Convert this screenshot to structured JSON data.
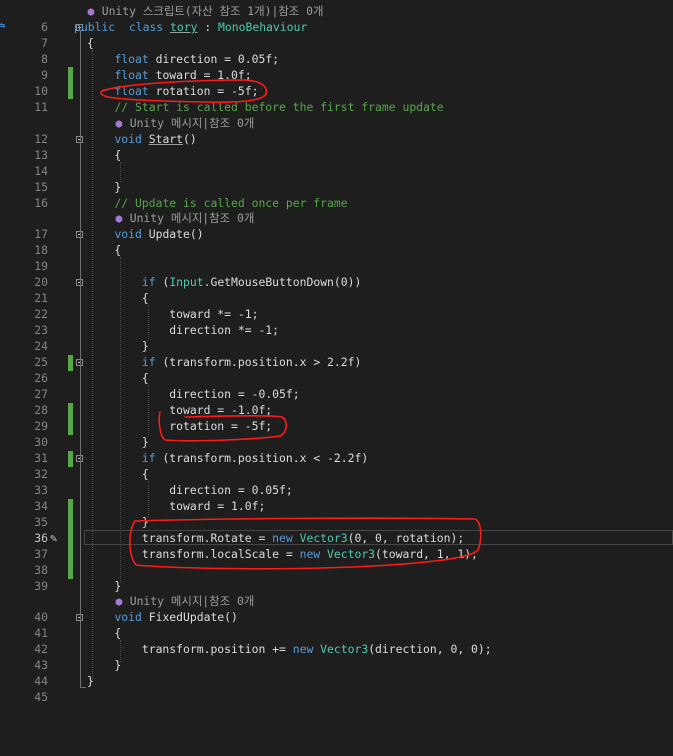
{
  "editor": {
    "lens_label": "Unity 메시지|참조 0개",
    "lens_label_class": "Unity 스크립트(자산 참조 1개)|참조 0개",
    "lines": [
      {
        "n": "6",
        "segs": [
          [
            "kw",
            "public"
          ],
          [
            "",
            "  "
          ],
          [
            "kw",
            "class"
          ],
          [
            "",
            " "
          ],
          [
            "type und",
            "tory"
          ],
          [
            "",
            " : "
          ],
          [
            "type",
            "MonoBehaviour"
          ]
        ]
      },
      {
        "n": "7",
        "segs": [
          [
            "",
            "{"
          ]
        ]
      },
      {
        "n": "8",
        "segs": [
          [
            "",
            "    "
          ],
          [
            "kw",
            "float"
          ],
          [
            "",
            " direction = 0.05f;"
          ]
        ]
      },
      {
        "n": "9",
        "segs": [
          [
            "",
            "    "
          ],
          [
            "kw",
            "float"
          ],
          [
            "",
            " toward = 1.0f;"
          ]
        ]
      },
      {
        "n": "10",
        "segs": [
          [
            "",
            "    "
          ],
          [
            "kw",
            "float"
          ],
          [
            "",
            " rotation = -5f;"
          ]
        ]
      },
      {
        "n": "11",
        "segs": [
          [
            "",
            "    "
          ],
          [
            "com",
            "// Start is called before the first frame update"
          ]
        ]
      },
      {
        "n": "12",
        "segs": [
          [
            "",
            "    "
          ],
          [
            "kw",
            "void"
          ],
          [
            "",
            " "
          ],
          [
            "und",
            "Start"
          ],
          [
            "",
            "()"
          ]
        ]
      },
      {
        "n": "13",
        "segs": [
          [
            "",
            "    {"
          ]
        ]
      },
      {
        "n": "14",
        "segs": [
          [
            "",
            ""
          ]
        ]
      },
      {
        "n": "15",
        "segs": [
          [
            "",
            "    }"
          ]
        ]
      },
      {
        "n": "16",
        "segs": [
          [
            "",
            "    "
          ],
          [
            "com",
            "// Update is called once per frame"
          ]
        ]
      },
      {
        "n": "17",
        "segs": [
          [
            "",
            "    "
          ],
          [
            "kw",
            "void"
          ],
          [
            "",
            " Update()"
          ]
        ]
      },
      {
        "n": "18",
        "segs": [
          [
            "",
            "    {"
          ]
        ]
      },
      {
        "n": "19",
        "segs": [
          [
            "",
            ""
          ]
        ]
      },
      {
        "n": "20",
        "segs": [
          [
            "",
            "        "
          ],
          [
            "kw",
            "if"
          ],
          [
            "",
            " ("
          ],
          [
            "type",
            "Input"
          ],
          [
            "",
            ".GetMouseButtonDown(0))"
          ]
        ]
      },
      {
        "n": "21",
        "segs": [
          [
            "",
            "        {"
          ]
        ]
      },
      {
        "n": "22",
        "segs": [
          [
            "",
            "            toward *= -1;"
          ]
        ]
      },
      {
        "n": "23",
        "segs": [
          [
            "",
            "            direction *= -1;"
          ]
        ]
      },
      {
        "n": "24",
        "segs": [
          [
            "",
            "        }"
          ]
        ]
      },
      {
        "n": "25",
        "segs": [
          [
            "",
            "        "
          ],
          [
            "kw",
            "if"
          ],
          [
            "",
            " (transform.position.x > 2.2f)"
          ]
        ]
      },
      {
        "n": "26",
        "segs": [
          [
            "",
            "        {"
          ]
        ]
      },
      {
        "n": "27",
        "segs": [
          [
            "",
            "            direction = -0.05f;"
          ]
        ]
      },
      {
        "n": "28",
        "segs": [
          [
            "",
            "            toward = -1.0f;"
          ]
        ]
      },
      {
        "n": "29",
        "segs": [
          [
            "",
            "            rotation = -5f;"
          ]
        ]
      },
      {
        "n": "30",
        "segs": [
          [
            "",
            "        }"
          ]
        ]
      },
      {
        "n": "31",
        "segs": [
          [
            "",
            "        "
          ],
          [
            "kw",
            "if"
          ],
          [
            "",
            " (transform.position.x < -2.2f)"
          ]
        ]
      },
      {
        "n": "32",
        "segs": [
          [
            "",
            "        {"
          ]
        ]
      },
      {
        "n": "33",
        "segs": [
          [
            "",
            "            direction = 0.05f;"
          ]
        ]
      },
      {
        "n": "34",
        "segs": [
          [
            "",
            "            toward = 1.0f;"
          ]
        ]
      },
      {
        "n": "35",
        "segs": [
          [
            "",
            "        }"
          ]
        ]
      },
      {
        "n": "36",
        "segs": [
          [
            "",
            "        transform.Rotate = "
          ],
          [
            "kw",
            "new"
          ],
          [
            "",
            " "
          ],
          [
            "type",
            "Vector3"
          ],
          [
            "",
            "(0, 0, rotation);"
          ]
        ]
      },
      {
        "n": "37",
        "segs": [
          [
            "",
            "        transform.localScale = "
          ],
          [
            "kw",
            "new"
          ],
          [
            "",
            " "
          ],
          [
            "type",
            "Vector3"
          ],
          [
            "",
            "(toward, 1, 1);"
          ]
        ]
      },
      {
        "n": "38",
        "segs": [
          [
            "",
            ""
          ]
        ]
      },
      {
        "n": "39",
        "segs": [
          [
            "",
            "    }"
          ]
        ]
      },
      {
        "n": "40",
        "segs": [
          [
            "",
            "    "
          ],
          [
            "kw",
            "void"
          ],
          [
            "",
            " FixedUpdate()"
          ]
        ]
      },
      {
        "n": "41",
        "segs": [
          [
            "",
            "    {"
          ]
        ]
      },
      {
        "n": "42",
        "segs": [
          [
            "",
            "        transform.position += "
          ],
          [
            "kw",
            "new"
          ],
          [
            "",
            " "
          ],
          [
            "type",
            "Vector3"
          ],
          [
            "",
            "(direction, 0, 0);"
          ]
        ]
      },
      {
        "n": "43",
        "segs": [
          [
            "",
            "    }"
          ]
        ]
      },
      {
        "n": "44",
        "segs": [
          [
            "",
            "}"
          ]
        ]
      },
      {
        "n": "45",
        "segs": [
          [
            "",
            ""
          ]
        ]
      }
    ]
  }
}
